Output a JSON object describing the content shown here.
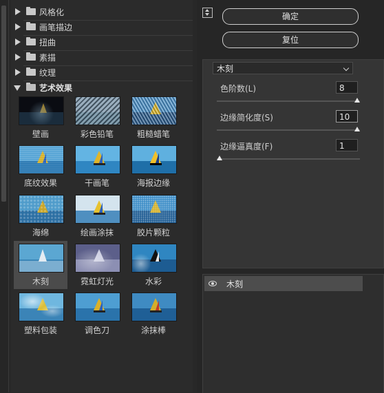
{
  "gallery": {
    "categories": [
      {
        "label": "风格化",
        "expanded": false
      },
      {
        "label": "画笔描边",
        "expanded": false
      },
      {
        "label": "扭曲",
        "expanded": false
      },
      {
        "label": "素描",
        "expanded": false
      },
      {
        "label": "纹理",
        "expanded": false
      },
      {
        "label": "艺术效果",
        "expanded": true
      }
    ],
    "filters": [
      {
        "label": "壁画"
      },
      {
        "label": "彩色铅笔"
      },
      {
        "label": "粗糙蜡笔"
      },
      {
        "label": "底纹效果"
      },
      {
        "label": "干画笔"
      },
      {
        "label": "海报边缘"
      },
      {
        "label": "海绵"
      },
      {
        "label": "绘画涂抹"
      },
      {
        "label": "胶片颗粒"
      },
      {
        "label": "木刻",
        "selected": true
      },
      {
        "label": "霓虹灯光"
      },
      {
        "label": "水彩"
      },
      {
        "label": "塑料包装"
      },
      {
        "label": "调色刀"
      },
      {
        "label": "涂抹棒"
      }
    ]
  },
  "controls": {
    "ok_label": "确定",
    "reset_label": "复位",
    "filter_select": "木刻",
    "params": [
      {
        "label": "色阶数(L)",
        "value": "8",
        "level": 1.0
      },
      {
        "label": "边缘简化度(S)",
        "value": "10",
        "level": 1.0
      },
      {
        "label": "边缘逼真度(F)",
        "value": "1",
        "level": 0.0
      }
    ]
  },
  "layers": {
    "items": [
      {
        "label": "木刻",
        "visible": true
      }
    ]
  },
  "colors": {
    "background": "#282828",
    "panel": "#353535",
    "selected_thumb": "#4b4b4b",
    "layer_row": "#4d4d4d"
  }
}
